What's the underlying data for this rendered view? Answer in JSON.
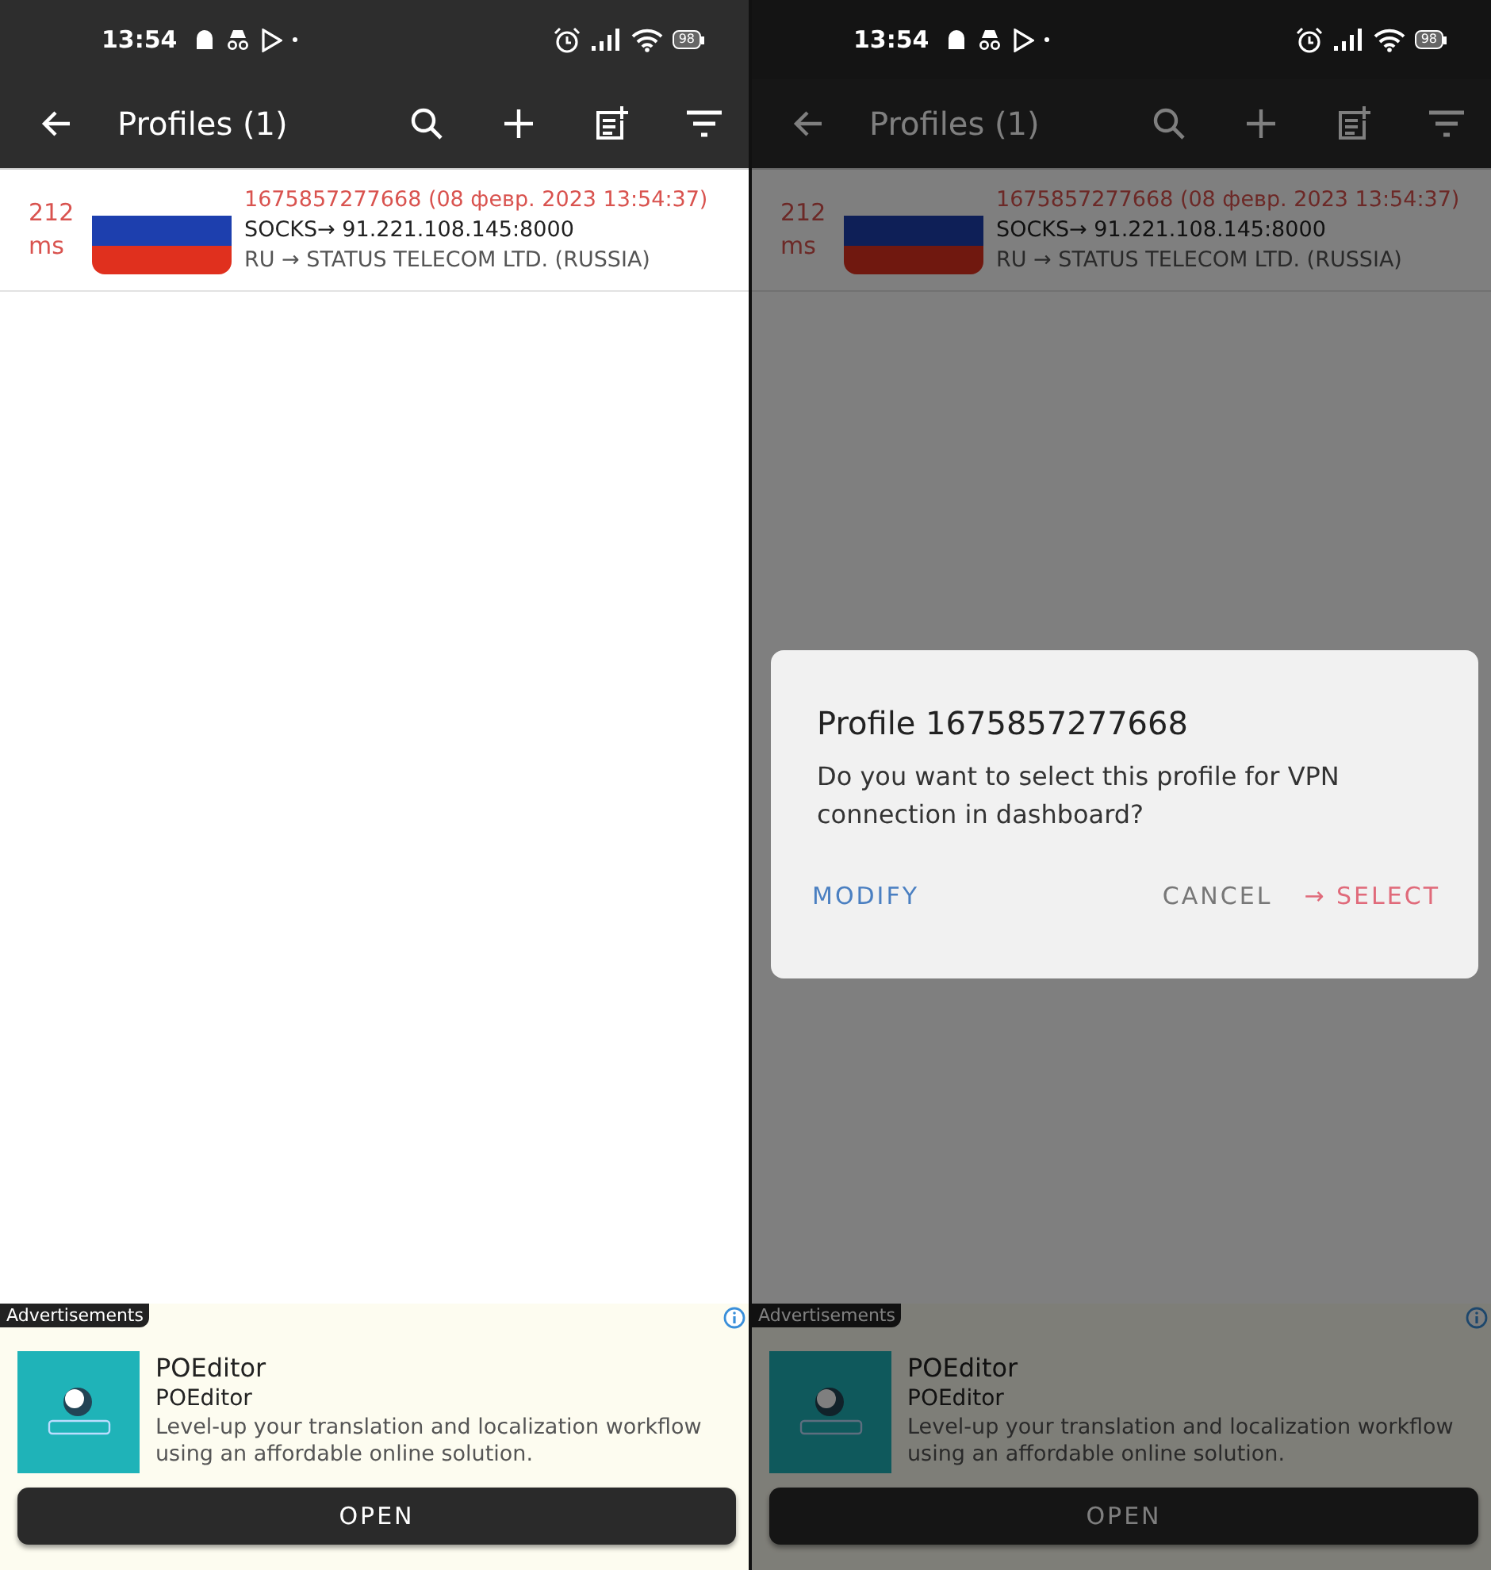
{
  "screens": [
    {
      "status_bar": {
        "time": "13:54",
        "battery": "98"
      },
      "toolbar": {
        "title": "Profiles (1)"
      },
      "profiles": [
        {
          "latency": "212 ms",
          "name": "1675857277668 (08 февр. 2023 13:54:37)",
          "server": "SOCKS→ 91.221.108.145:8000",
          "location": "RU → STATUS TELECOM LTD. (RUSSIA)"
        }
      ],
      "ad": {
        "tag": "Advertisements",
        "title": "POEditor",
        "subtitle": "POEditor",
        "description": "Level-up your translation and localization workflow using an affordable online solution.",
        "button": "OPEN"
      }
    },
    {
      "status_bar": {
        "time": "13:54",
        "battery": "98"
      },
      "toolbar": {
        "title": "Profiles (1)"
      },
      "profiles": [
        {
          "latency": "212 ms",
          "name": "1675857277668 (08 февр. 2023 13:54:37)",
          "server": "SOCKS→ 91.221.108.145:8000",
          "location": "RU → STATUS TELECOM LTD. (RUSSIA)"
        }
      ],
      "ad": {
        "tag": "Advertisements",
        "title": "POEditor",
        "subtitle": "POEditor",
        "description": "Level-up your translation and localization workflow using an affordable online solution.",
        "button": "OPEN"
      },
      "dialog": {
        "title": "Profile 1675857277668",
        "message": "Do you want to select this profile for VPN connection in dashboard?",
        "actions": [
          {
            "label": "MODIFY",
            "kind": "modify"
          },
          {
            "label": "CANCEL",
            "kind": "cancel"
          },
          {
            "label": "→ SELECT",
            "kind": "confirm"
          }
        ]
      }
    }
  ]
}
